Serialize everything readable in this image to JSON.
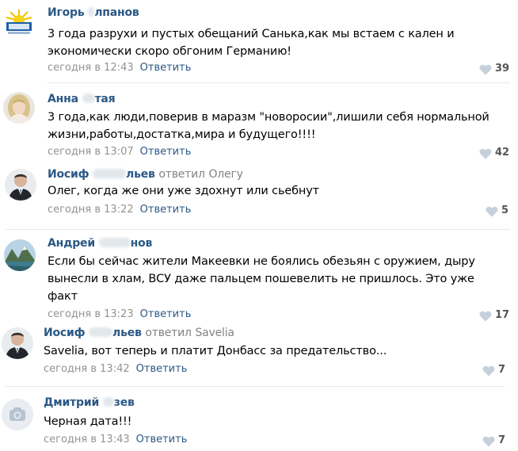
{
  "comments": [
    {
      "author_visible": "Игорь",
      "author_tail": "лпанов",
      "reply_prefix": "",
      "reply_target": "",
      "text": "3 года разрухи и пустых обещаний Санька,как мы встаем с кален и экономически скоро обгоним Германию!",
      "time": "сегодня в 12:43",
      "reply_label": "Ответить",
      "likes": "39",
      "avatar": "sunrise-logo-avatar"
    },
    {
      "author_visible": "Анна",
      "author_tail": "тая",
      "reply_prefix": "",
      "reply_target": "",
      "text": "3 года,как люди,поверив в маразм \"новоросии\",лишили себя нормальной жизни,работы,достатка,мира и будущего!!!!",
      "time": "сегодня в 13:07",
      "reply_label": "Ответить",
      "likes": "42",
      "avatar": "blonde-woman-avatar"
    },
    {
      "author_visible": "Иосиф",
      "author_tail": "льев",
      "reply_prefix": "ответил",
      "reply_target": "Олегу",
      "text": "Олег, когда же они уже здохнут или сьебнут",
      "time": "сегодня в 13:22",
      "reply_label": "Ответить",
      "likes": "5",
      "avatar": "man-in-suit-avatar"
    },
    {
      "author_visible": "Андрей",
      "author_tail": "нов",
      "reply_prefix": "",
      "reply_target": "",
      "text": "Если бы сейчас жители Макеевки не боялись обезьян с оружием, дыру вынесли в хлам, ВСУ даже пальцем пошевелить не пришлось. Это уже факт",
      "time": "сегодня в 13:23",
      "reply_label": "Ответить",
      "likes": "17",
      "avatar": "mountain-lake-avatar"
    },
    {
      "author_visible": "Иосиф",
      "author_tail": "льев",
      "reply_prefix": "ответил",
      "reply_target": "Savelia",
      "text": "Savelia, вот теперь и платит Донбасс за предательство...",
      "time": "сегодня в 13:42",
      "reply_label": "Ответить",
      "likes": "7",
      "avatar": "man-in-suit-avatar"
    },
    {
      "author_visible": "Дмитрий",
      "author_tail": "зев",
      "reply_prefix": "",
      "reply_target": "",
      "text": "Черная дата!!!",
      "time": "сегодня в 13:43",
      "reply_label": "Ответить",
      "likes": "7",
      "avatar": "camera-placeholder-avatar"
    }
  ]
}
